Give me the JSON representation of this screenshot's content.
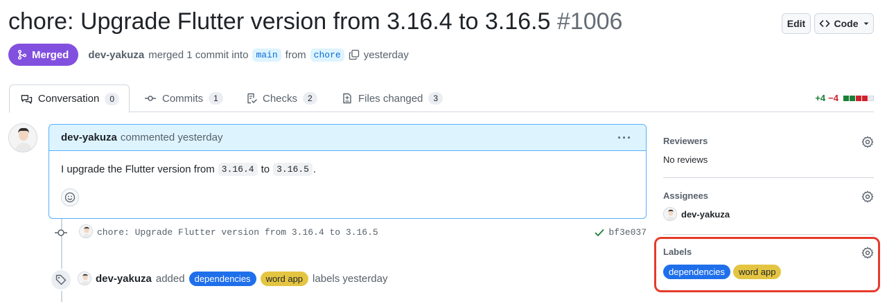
{
  "header": {
    "title": "chore: Upgrade Flutter version from 3.16.4 to 3.16.5",
    "number": "#1006",
    "edit_label": "Edit",
    "code_label": "Code",
    "state_label": "Merged",
    "author": "dev-yakuza",
    "merge_text": "merged 1 commit into",
    "base_branch": "main",
    "from_text": "from",
    "head_branch": "chore",
    "time": "yesterday"
  },
  "tabs": [
    {
      "label": "Conversation",
      "count": "0",
      "icon": "comment-discussion-icon"
    },
    {
      "label": "Commits",
      "count": "1",
      "icon": "git-commit-icon"
    },
    {
      "label": "Checks",
      "count": "2",
      "icon": "checklist-icon"
    },
    {
      "label": "Files changed",
      "count": "3",
      "icon": "file-diff-icon"
    }
  ],
  "diffstat": {
    "additions": "+4",
    "deletions": "−4"
  },
  "comment": {
    "author": "dev-yakuza",
    "action": "commented yesterday",
    "text_before": "I upgrade the Flutter version from",
    "from_version": "3.16.4",
    "to_text": "to",
    "to_version": "3.16.5",
    "end": "."
  },
  "commit": {
    "message": "chore: Upgrade Flutter version from 3.16.4 to 3.16.5",
    "sha": "bf3e037",
    "status": "success"
  },
  "label_event": {
    "author": "dev-yakuza",
    "action": "added",
    "labels": [
      "dependencies",
      "word app"
    ],
    "suffix": "labels yesterday"
  },
  "sidebar": {
    "reviewers": {
      "title": "Reviewers",
      "value": "No reviews"
    },
    "assignees": {
      "title": "Assignees",
      "value": "dev-yakuza"
    },
    "labels": {
      "title": "Labels",
      "items": [
        "dependencies",
        "word app"
      ]
    }
  },
  "colors": {
    "merged": "#8250df",
    "label_dependencies": "#1f6feb",
    "label_word_app": "#e4c542",
    "highlight": "#e53c2a"
  }
}
